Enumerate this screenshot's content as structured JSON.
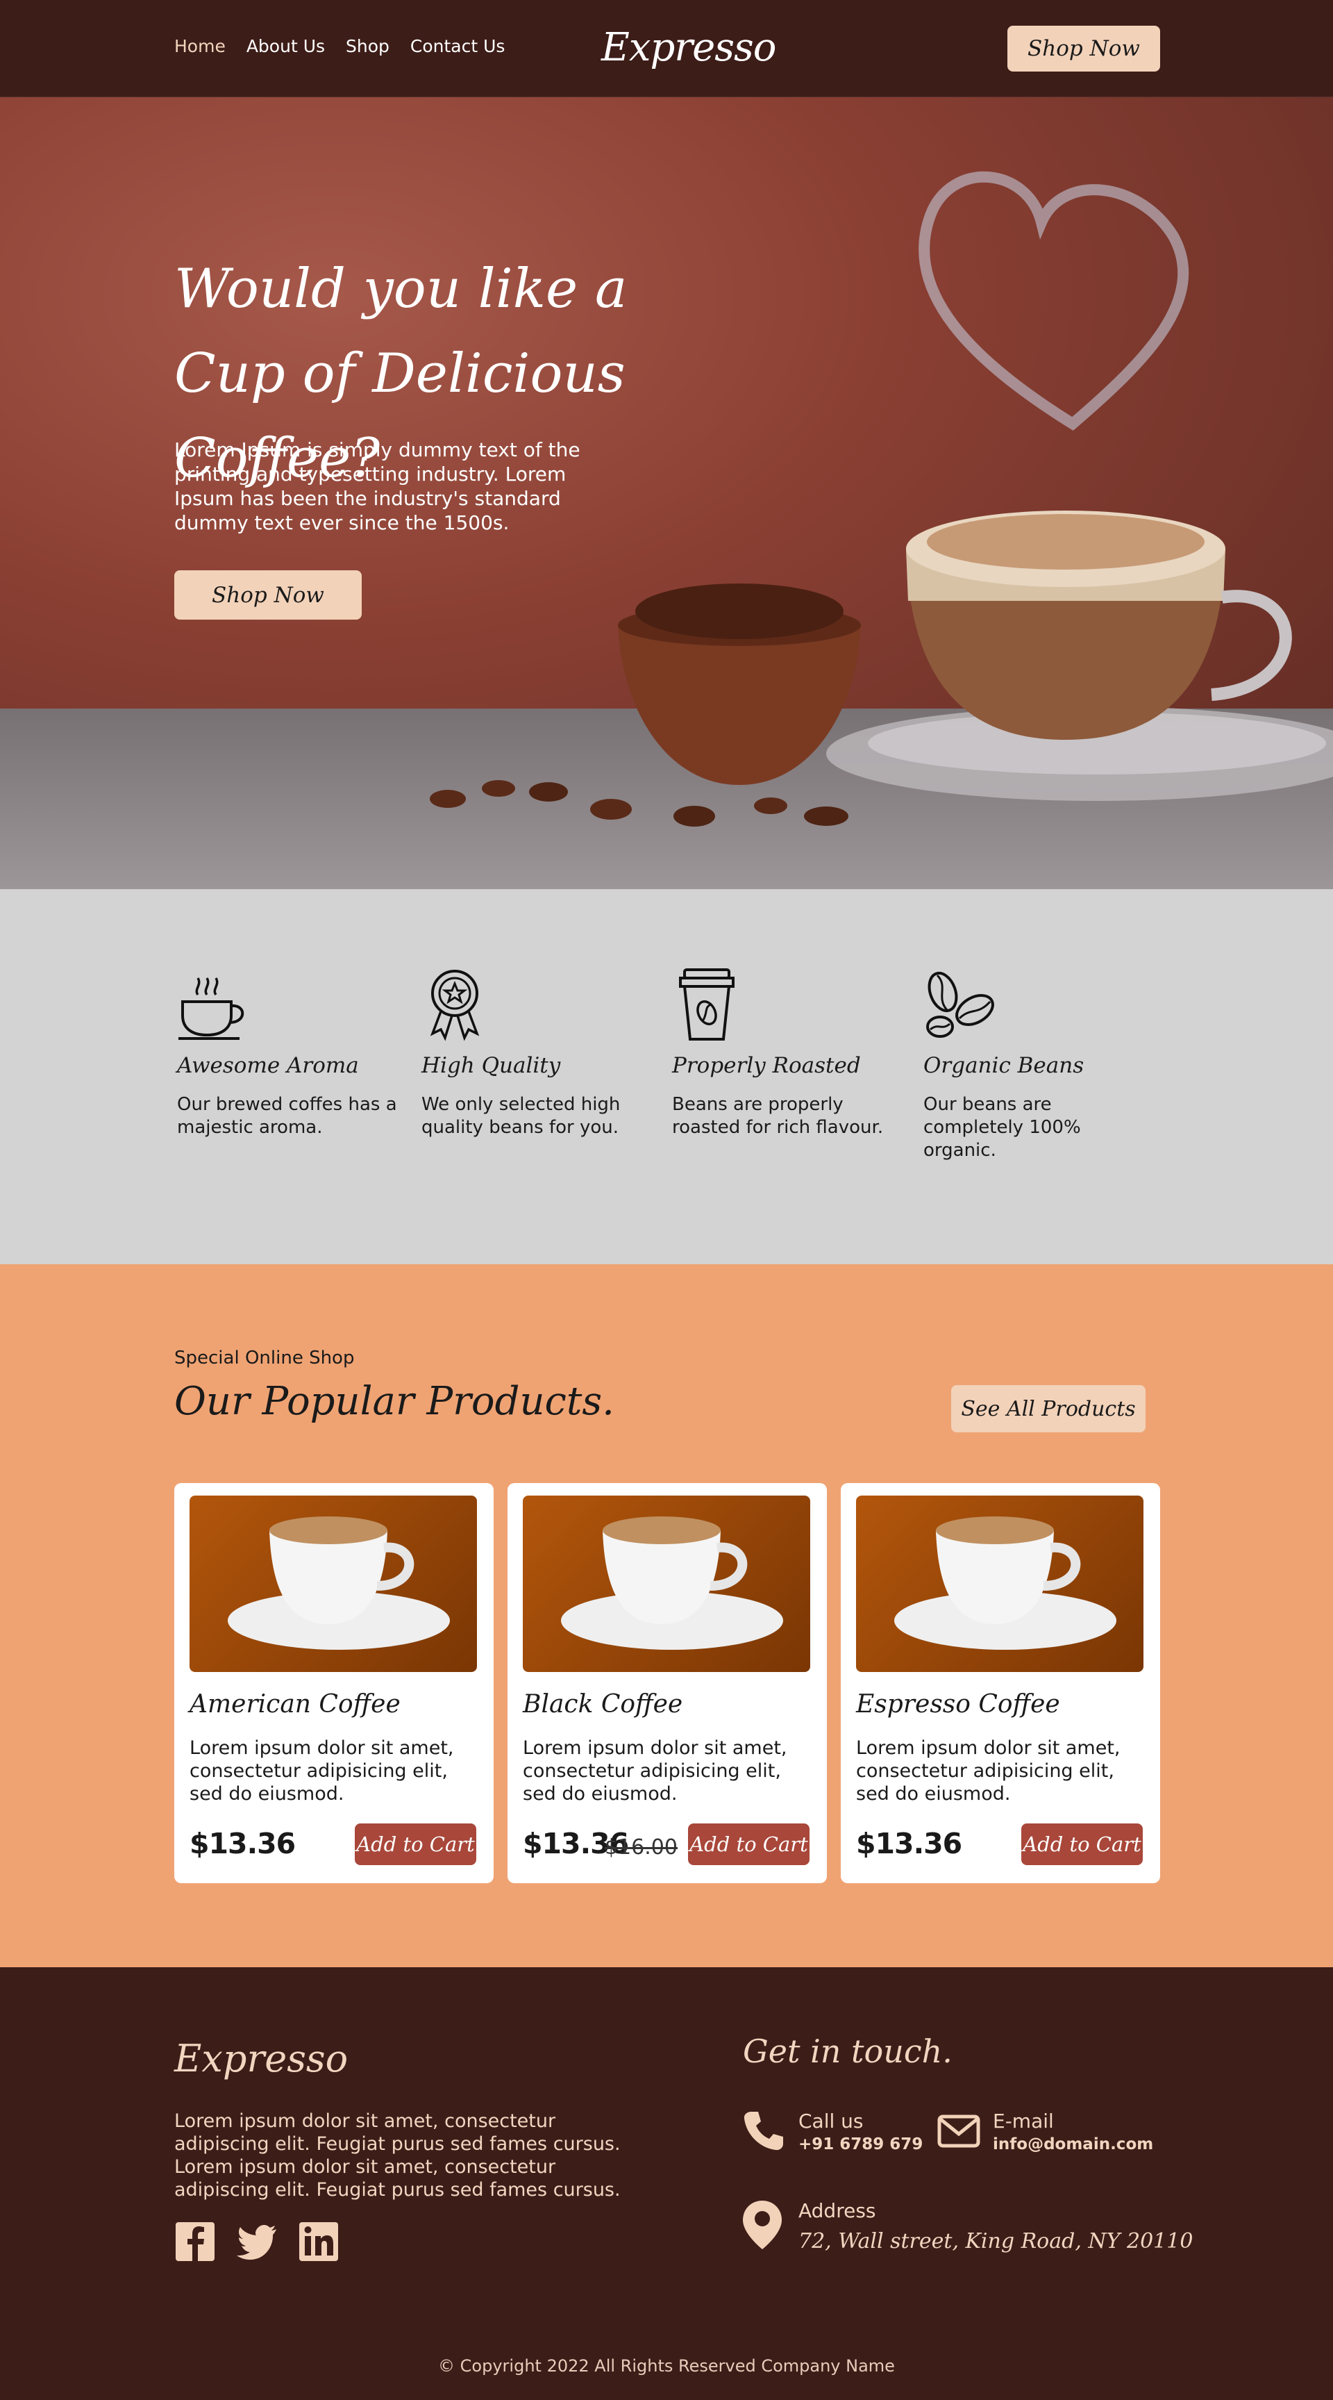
{
  "nav": {
    "links": [
      "Home",
      "About Us",
      "Shop",
      "Contact Us"
    ],
    "logo": "Expresso",
    "cta": "Shop Now"
  },
  "hero": {
    "title": "Would you like a Cup of Delicious Coffee?",
    "text": "Lorem Ipsum is simply dummy text of the printing and typesetting industry. Lorem Ipsum has been the industry's standard dummy text ever since the 1500s.",
    "cta": "Shop Now"
  },
  "features": [
    {
      "icon": "coffee-cup-icon",
      "title": "Awesome Aroma",
      "text": "Our brewed coffes has a majestic aroma."
    },
    {
      "icon": "award-medal-icon",
      "title": "High Quality",
      "text": "We only selected high quality beans for you."
    },
    {
      "icon": "takeaway-cup-icon",
      "title": "Properly Roasted",
      "text": "Beans are properly roasted for rich flavour."
    },
    {
      "icon": "coffee-beans-icon",
      "title": "Organic Beans",
      "text": "Our beans are completely 100% organic."
    }
  ],
  "products": {
    "kicker": "Special Online Shop",
    "title": "Our Popular Products.",
    "see_all": "See All Products",
    "items": [
      {
        "name": "American Coffee",
        "desc": "Lorem ipsum dolor sit amet, consectetur adipisicing elit, sed do eiusmod.",
        "price": "$13.36",
        "old_price": "",
        "cta": "Add to Cart"
      },
      {
        "name": "Black Coffee",
        "desc": "Lorem ipsum dolor sit amet, consectetur adipisicing elit, sed do eiusmod.",
        "price": "$13.36",
        "old_price": "$16.00",
        "cta": "Add to Cart"
      },
      {
        "name": "Espresso Coffee",
        "desc": "Lorem ipsum dolor sit amet, consectetur adipisicing elit, sed do eiusmod.",
        "price": "$13.36",
        "old_price": "",
        "cta": "Add to Cart"
      }
    ]
  },
  "footer": {
    "logo": "Expresso",
    "desc": "Lorem ipsum dolor sit amet, consectetur adipiscing elit. Feugiat purus sed fames cursus. Lorem ipsum dolor sit amet, consectetur adipiscing elit. Feugiat purus sed fames cursus.",
    "social": [
      "facebook-icon",
      "twitter-icon",
      "linkedin-icon"
    ],
    "touch_title": "Get in touch.",
    "call_label": "Call us",
    "call_value": "+91 6789 679",
    "email_label": "E-mail",
    "email_value": "info@domain.com",
    "address_label": "Address",
    "address_value": "72, Wall street, King Road, NY 20110",
    "copyright": "© Copyright 2022 All Rights Reserved Company Name"
  },
  "colors": {
    "dark_brown": "#3c1d18",
    "peach": "#f2d2b9",
    "orange": "#efa373",
    "rust": "#a8473a",
    "grey": "#d3d3d3"
  }
}
